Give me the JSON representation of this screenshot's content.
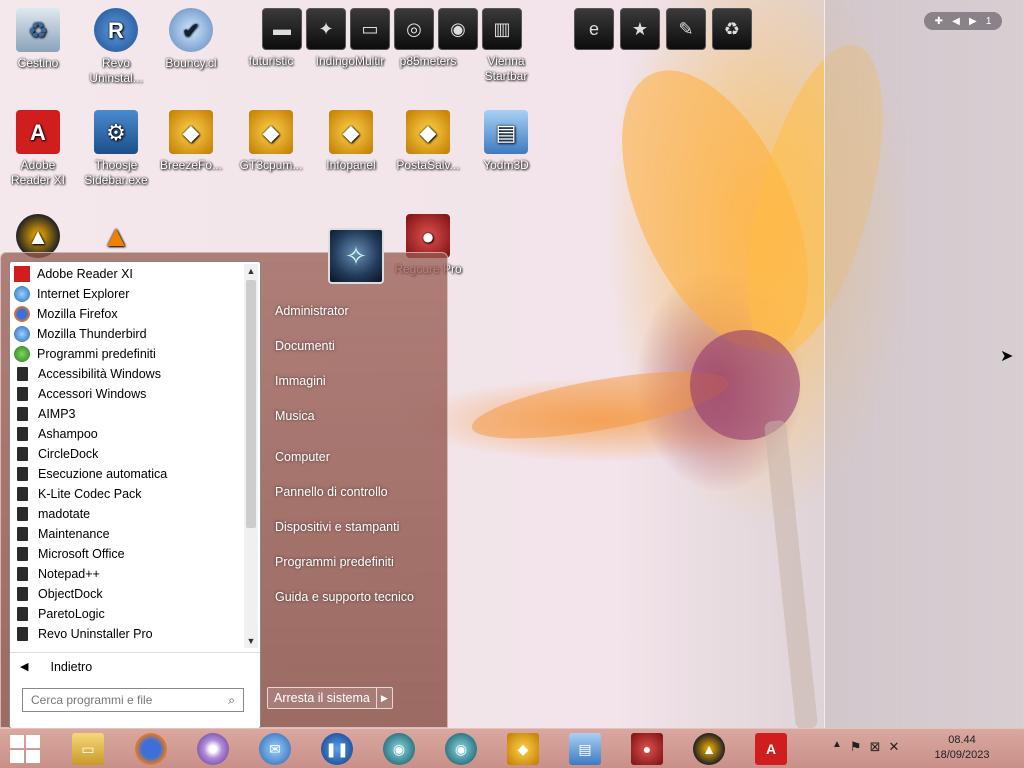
{
  "desktop": {
    "icons": [
      {
        "label": "Cestino"
      },
      {
        "label": "Revo Uninstal..."
      },
      {
        "label": "Bouncy.cl"
      },
      {
        "label": "futuristic"
      },
      {
        "label": "IndingoMultir"
      },
      {
        "label": "p85meters"
      },
      {
        "label": "Vienna Startbar"
      },
      {
        "label": "Adobe Reader XI"
      },
      {
        "label": "Thoosje Sidebar.exe"
      },
      {
        "label": "BreezeFo..."
      },
      {
        "label": "GT3cpum..."
      },
      {
        "label": "Infopanel"
      },
      {
        "label": "PostaSalv..."
      },
      {
        "label": "Yodm3D"
      },
      {
        "label": "Regcure Pro"
      }
    ],
    "virtual_desktop": {
      "page": "1"
    }
  },
  "start_menu": {
    "programs": [
      {
        "label": "Adobe Reader XI",
        "icon": "pdf-icon"
      },
      {
        "label": "Internet Explorer",
        "icon": "ie-icon"
      },
      {
        "label": "Mozilla Firefox",
        "icon": "firefox-icon"
      },
      {
        "label": "Mozilla Thunderbird",
        "icon": "thunderbird-icon"
      },
      {
        "label": "Programmi predefiniti",
        "icon": "defaults-icon"
      },
      {
        "label": "Accessibilità Windows",
        "icon": "folder-icon"
      },
      {
        "label": "Accessori Windows",
        "icon": "folder-icon"
      },
      {
        "label": "AIMP3",
        "icon": "folder-icon"
      },
      {
        "label": "Ashampoo",
        "icon": "folder-icon"
      },
      {
        "label": "CircleDock",
        "icon": "folder-icon"
      },
      {
        "label": "Esecuzione automatica",
        "icon": "folder-icon"
      },
      {
        "label": "K-Lite Codec Pack",
        "icon": "folder-icon"
      },
      {
        "label": "madotate",
        "icon": "folder-icon"
      },
      {
        "label": "Maintenance",
        "icon": "folder-icon"
      },
      {
        "label": "Microsoft Office",
        "icon": "folder-icon"
      },
      {
        "label": "Notepad++",
        "icon": "folder-icon"
      },
      {
        "label": "ObjectDock",
        "icon": "folder-icon"
      },
      {
        "label": "ParetoLogic",
        "icon": "folder-icon"
      },
      {
        "label": "Revo Uninstaller Pro",
        "icon": "folder-icon"
      }
    ],
    "back_label": "Indietro",
    "search_placeholder": "Cerca programmi e file",
    "right_items": [
      {
        "label": "Administrator"
      },
      {
        "label": "Documenti"
      },
      {
        "label": "Immagini"
      },
      {
        "label": "Musica"
      },
      {
        "label": "Computer"
      },
      {
        "label": "Pannello di controllo"
      },
      {
        "label": "Dispositivi e stampanti"
      },
      {
        "label": "Programmi predefiniti"
      },
      {
        "label": "Guida e supporto tecnico"
      }
    ],
    "shutdown_label": "Arresta il sistema"
  },
  "taskbar": {
    "clock_time": "08.44",
    "clock_date": "18/09/2023",
    "accent": "#c99088"
  }
}
